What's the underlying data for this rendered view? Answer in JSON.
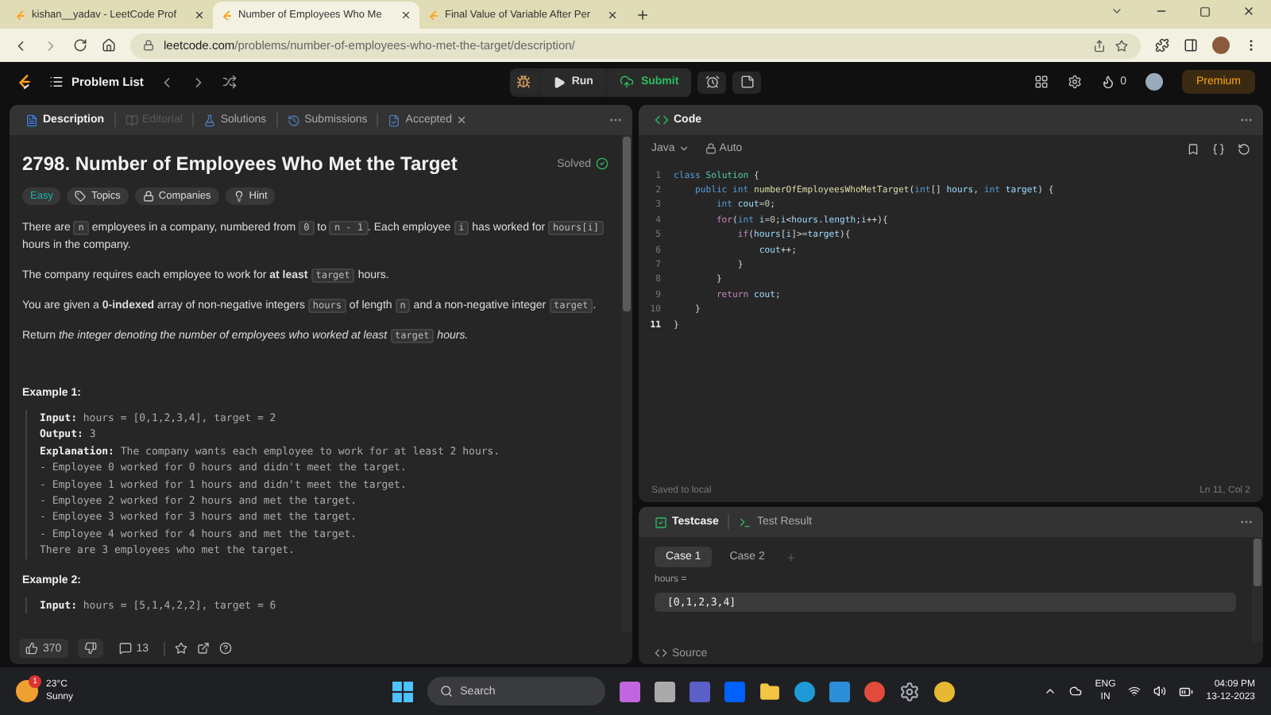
{
  "browser": {
    "tabs": [
      {
        "title": "kishan__yadav - LeetCode Prof",
        "selected": false
      },
      {
        "title": "Number of Employees Who Me",
        "selected": true
      },
      {
        "title": "Final Value of Variable After Per",
        "selected": false
      }
    ],
    "url_host": "leetcode.com",
    "url_path": "/problems/number-of-employees-who-met-the-target/description/"
  },
  "navbar": {
    "problem_list": "Problem List",
    "run": "Run",
    "submit": "Submit",
    "streak": "0",
    "premium": "Premium"
  },
  "description_panel": {
    "tabs": [
      {
        "label": "Description",
        "kind": "description",
        "selected": true,
        "disabled": false
      },
      {
        "label": "Editorial",
        "kind": "editorial",
        "selected": false,
        "disabled": true
      },
      {
        "label": "Solutions",
        "kind": "solutions",
        "selected": false,
        "disabled": false
      },
      {
        "label": "Submissions",
        "kind": "submissions",
        "selected": false,
        "disabled": false
      },
      {
        "label": "Accepted",
        "kind": "accepted",
        "selected": false,
        "disabled": false
      }
    ],
    "title": "2798. Number of Employees Who Met the Target",
    "status": "Solved",
    "tags": [
      {
        "label": "Easy",
        "kind": "difficulty"
      },
      {
        "label": "Topics",
        "kind": "topics"
      },
      {
        "label": "Companies",
        "kind": "companies"
      },
      {
        "label": "Hint",
        "kind": "hint"
      }
    ],
    "paragraphs": [
      [
        {
          "kind": "plain",
          "text": "There are "
        },
        {
          "kind": "code",
          "text": "n"
        },
        {
          "kind": "plain",
          "text": " employees in a company, numbered from "
        },
        {
          "kind": "code",
          "text": "0"
        },
        {
          "kind": "plain",
          "text": " to "
        },
        {
          "kind": "code",
          "text": "n - 1"
        },
        {
          "kind": "plain",
          "text": ". Each employee "
        },
        {
          "kind": "code",
          "text": "i"
        },
        {
          "kind": "plain",
          "text": " has worked for "
        },
        {
          "kind": "code",
          "text": "hours[i]"
        },
        {
          "kind": "plain",
          "text": " hours in the company."
        }
      ],
      [
        {
          "kind": "plain",
          "text": "The company requires each employee to work for "
        },
        {
          "kind": "bold",
          "text": "at least "
        },
        {
          "kind": "code",
          "text": "target"
        },
        {
          "kind": "plain",
          "text": " hours."
        }
      ],
      [
        {
          "kind": "plain",
          "text": "You are given a "
        },
        {
          "kind": "bold",
          "text": "0-indexed"
        },
        {
          "kind": "plain",
          "text": " array of non-negative integers "
        },
        {
          "kind": "code",
          "text": "hours"
        },
        {
          "kind": "plain",
          "text": " of length "
        },
        {
          "kind": "code",
          "text": "n"
        },
        {
          "kind": "plain",
          "text": " and a non-negative integer "
        },
        {
          "kind": "code",
          "text": "target"
        },
        {
          "kind": "plain",
          "text": "."
        }
      ],
      [
        {
          "kind": "plain",
          "text": "Return "
        },
        {
          "kind": "italic",
          "text": "the integer denoting the number of employees who worked at least "
        },
        {
          "kind": "code",
          "text": "target"
        },
        {
          "kind": "italic",
          "text": " hours."
        }
      ]
    ],
    "examples": [
      {
        "heading": "Example 1:",
        "lines": [
          {
            "label": "Input:",
            "text": " hours = [0,1,2,3,4], target = 2"
          },
          {
            "label": "Output:",
            "text": " 3"
          },
          {
            "label": "Explanation:",
            "text": " The company wants each employee to work for at least 2 hours."
          },
          {
            "text": "- Employee 0 worked for 0 hours and didn't meet the target."
          },
          {
            "text": "- Employee 1 worked for 1 hours and didn't meet the target."
          },
          {
            "text": "- Employee 2 worked for 2 hours and met the target."
          },
          {
            "text": "- Employee 3 worked for 3 hours and met the target."
          },
          {
            "text": "- Employee 4 worked for 4 hours and met the target."
          },
          {
            "text": "There are 3 employees who met the target."
          }
        ]
      },
      {
        "heading": "Example 2:",
        "lines": [
          {
            "label": "Input:",
            "text": " hours = [5,1,4,2,2], target = 6"
          }
        ]
      }
    ],
    "likes": "370",
    "comments": "13"
  },
  "code_panel": {
    "title": "Code",
    "language": "Java",
    "mode": "Auto",
    "lines": [
      {
        "no": "1",
        "current": false,
        "tokens": [
          {
            "kind": "keyword",
            "text": "class"
          },
          {
            "kind": "type",
            "text": " Solution"
          },
          {
            "kind": "plain",
            "text": " {"
          }
        ]
      },
      {
        "no": "2",
        "current": false,
        "tokens": [
          {
            "kind": "keyword",
            "text": "    public int"
          },
          {
            "kind": "function",
            "text": " numberOfEmployeesWhoMetTarget"
          },
          {
            "kind": "plain",
            "text": "("
          },
          {
            "kind": "keyword",
            "text": "int"
          },
          {
            "kind": "plain",
            "text": "[] "
          },
          {
            "kind": "variable",
            "text": "hours"
          },
          {
            "kind": "plain",
            "text": ", "
          },
          {
            "kind": "keyword",
            "text": "int"
          },
          {
            "kind": "variable",
            "text": " target"
          },
          {
            "kind": "plain",
            "text": ") {"
          }
        ]
      },
      {
        "no": "3",
        "current": false,
        "tokens": [
          {
            "kind": "keyword",
            "text": "        int"
          },
          {
            "kind": "variable",
            "text": " cout"
          },
          {
            "kind": "plain",
            "text": "="
          },
          {
            "kind": "number",
            "text": "0"
          },
          {
            "kind": "plain",
            "text": ";"
          }
        ]
      },
      {
        "no": "4",
        "current": false,
        "tokens": [
          {
            "kind": "control",
            "text": "        for"
          },
          {
            "kind": "plain",
            "text": "("
          },
          {
            "kind": "keyword",
            "text": "int"
          },
          {
            "kind": "variable",
            "text": " i"
          },
          {
            "kind": "plain",
            "text": "="
          },
          {
            "kind": "number",
            "text": "0"
          },
          {
            "kind": "plain",
            "text": ";"
          },
          {
            "kind": "variable",
            "text": "i"
          },
          {
            "kind": "plain",
            "text": "<"
          },
          {
            "kind": "variable",
            "text": "hours"
          },
          {
            "kind": "plain",
            "text": "."
          },
          {
            "kind": "variable",
            "text": "length"
          },
          {
            "kind": "plain",
            "text": ";"
          },
          {
            "kind": "variable",
            "text": "i"
          },
          {
            "kind": "plain",
            "text": "++){"
          }
        ]
      },
      {
        "no": "5",
        "current": false,
        "tokens": [
          {
            "kind": "control",
            "text": "            if"
          },
          {
            "kind": "plain",
            "text": "("
          },
          {
            "kind": "variable",
            "text": "hours"
          },
          {
            "kind": "plain",
            "text": "["
          },
          {
            "kind": "variable",
            "text": "i"
          },
          {
            "kind": "plain",
            "text": "]>="
          },
          {
            "kind": "variable",
            "text": "target"
          },
          {
            "kind": "plain",
            "text": "){"
          }
        ]
      },
      {
        "no": "6",
        "current": false,
        "tokens": [
          {
            "kind": "variable",
            "text": "                cout"
          },
          {
            "kind": "plain",
            "text": "++;"
          }
        ]
      },
      {
        "no": "7",
        "current": false,
        "tokens": [
          {
            "kind": "plain",
            "text": "            }"
          }
        ]
      },
      {
        "no": "8",
        "current": false,
        "tokens": [
          {
            "kind": "plain",
            "text": "        }"
          }
        ]
      },
      {
        "no": "9",
        "current": false,
        "tokens": [
          {
            "kind": "control",
            "text": "        return"
          },
          {
            "kind": "variable",
            "text": " cout"
          },
          {
            "kind": "plain",
            "text": ";"
          }
        ]
      },
      {
        "no": "10",
        "current": false,
        "tokens": [
          {
            "kind": "plain",
            "text": "    }"
          }
        ]
      },
      {
        "no": "11",
        "current": true,
        "tokens": [
          {
            "kind": "plain",
            "text": "}"
          }
        ]
      }
    ],
    "status": "Saved to local",
    "cursor": "Ln 11, Col 2"
  },
  "testcase_panel": {
    "tabs": [
      {
        "label": "Testcase",
        "kind": "testcase",
        "selected": true
      },
      {
        "label": "Test Result",
        "kind": "result",
        "selected": false
      }
    ],
    "cases": [
      {
        "label": "Case 1",
        "selected": true
      },
      {
        "label": "Case 2",
        "selected": false
      }
    ],
    "add": "+",
    "param": "hours =",
    "value": "[0,1,2,3,4]",
    "source": "Source"
  },
  "taskbar": {
    "temperature": "23°C",
    "weather": "Sunny",
    "badge": "1",
    "search": "Search",
    "language": "ENG",
    "region": "IN",
    "time": "04:09 PM",
    "date": "13-12-2023"
  }
}
